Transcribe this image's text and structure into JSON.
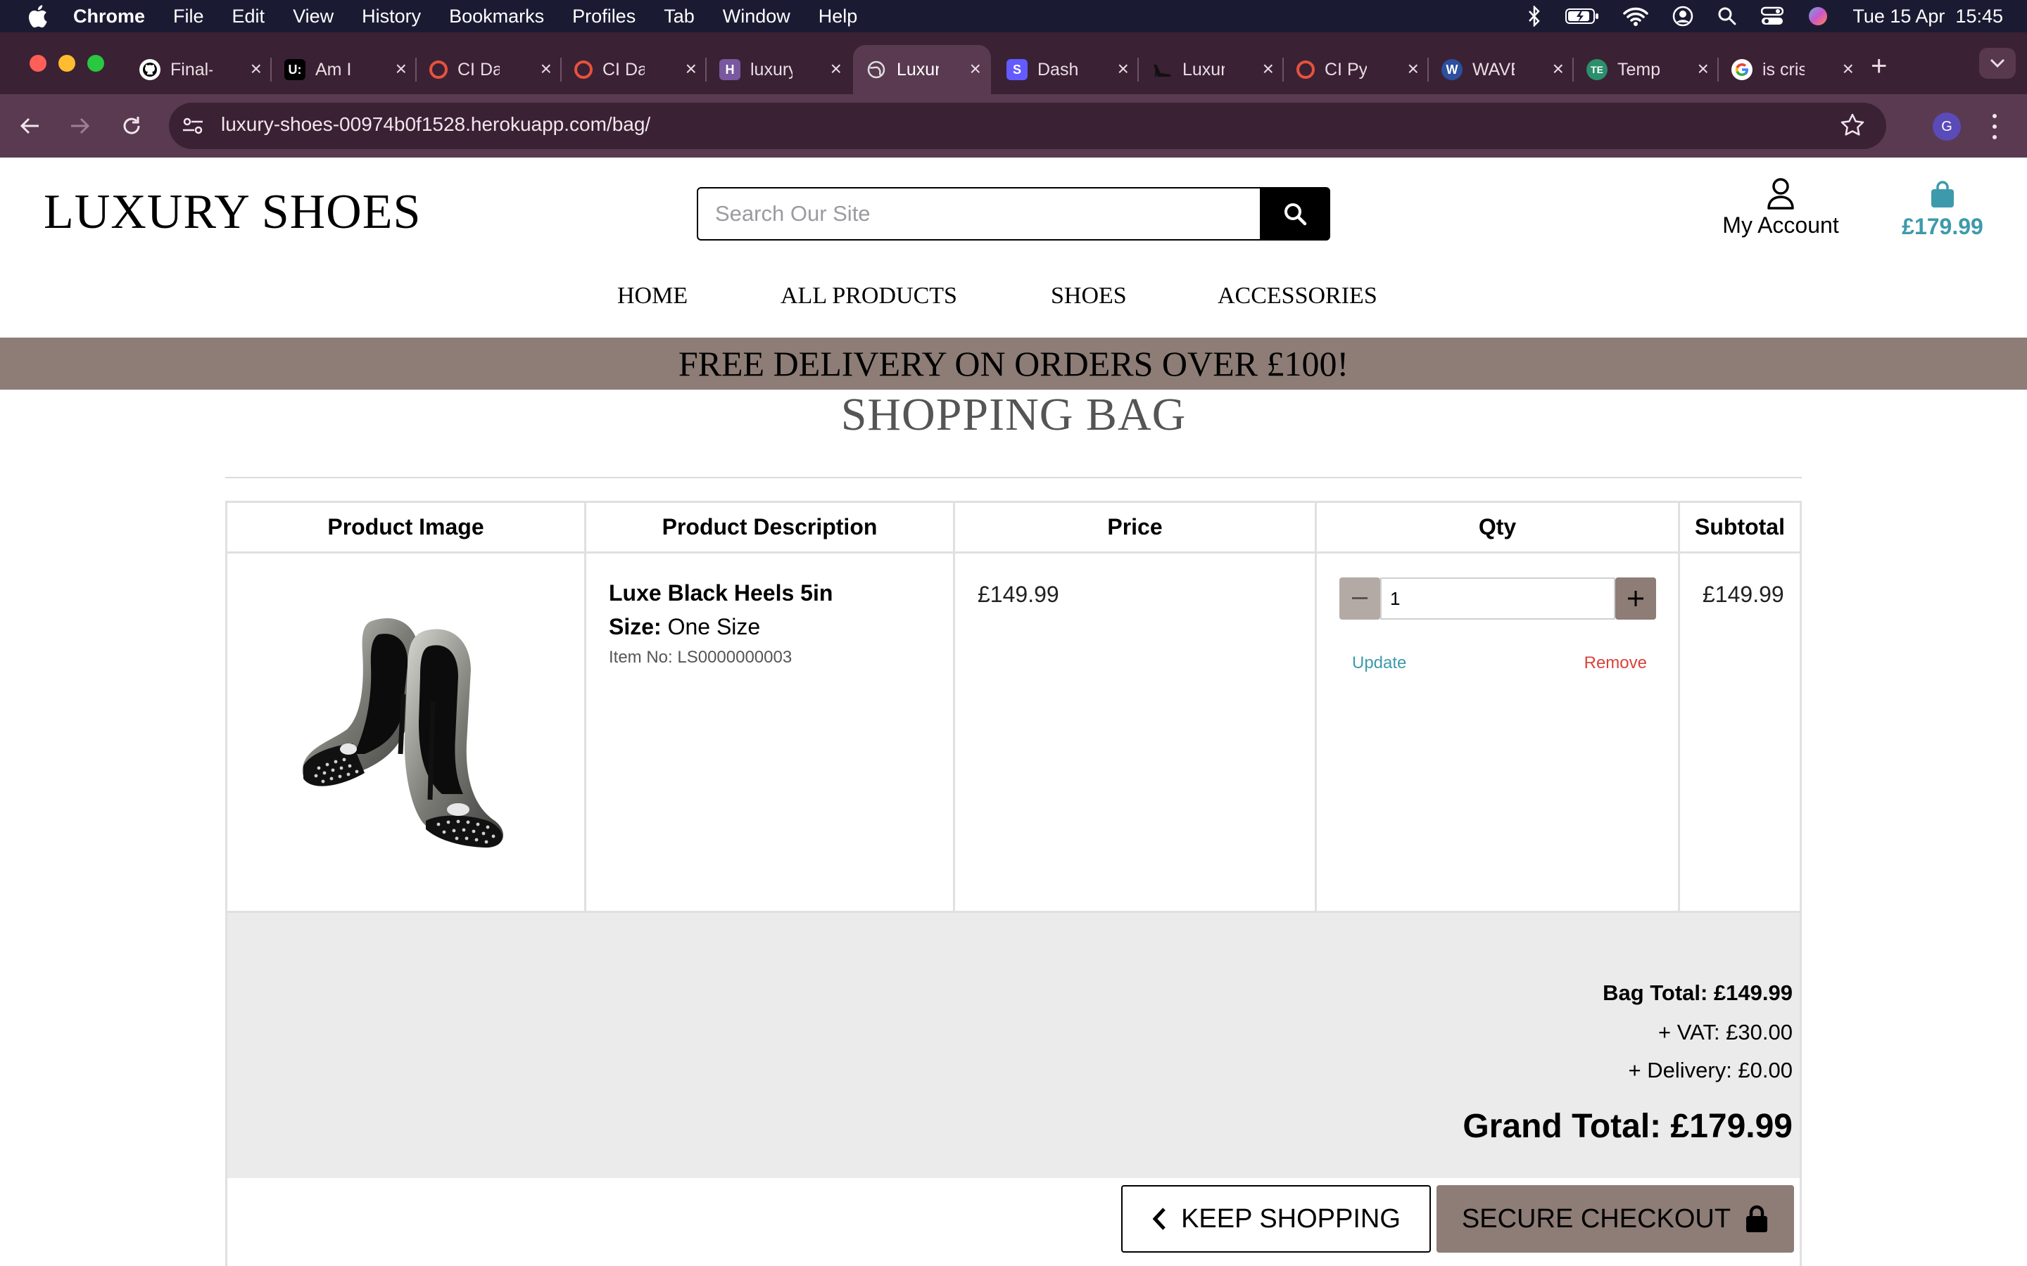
{
  "menubar": {
    "app": "Chrome",
    "items": [
      "File",
      "Edit",
      "View",
      "History",
      "Bookmarks",
      "Profiles",
      "Tab",
      "Window",
      "Help"
    ],
    "clock": "Tue 15 Apr  15:45"
  },
  "tabs": [
    {
      "title": "Final-",
      "icon": "github-icon"
    },
    {
      "title": "Am I F",
      "icon": "amiresponsive-icon"
    },
    {
      "title": "CI Dat",
      "icon": "ci-icon"
    },
    {
      "title": "CI Dat",
      "icon": "ci-icon"
    },
    {
      "title": "luxury",
      "icon": "heroku-icon"
    },
    {
      "title": "Luxur",
      "icon": "globe-icon",
      "active": true
    },
    {
      "title": "Dashb",
      "icon": "stripe-icon"
    },
    {
      "title": "Luxur",
      "icon": "shoe-icon"
    },
    {
      "title": "CI Py",
      "icon": "ci-icon"
    },
    {
      "title": "WAVE",
      "icon": "wave-icon"
    },
    {
      "title": "Temp",
      "icon": "temp-icon"
    },
    {
      "title": "is cris",
      "icon": "google-icon"
    }
  ],
  "browser": {
    "url": "luxury-shoes-00974b0f1528.herokuapp.com/bag/",
    "profile_initial": "G"
  },
  "site": {
    "logo": "LUXURY SHOES",
    "search_placeholder": "Search Our Site",
    "account_label": "My Account",
    "bag_total": "£179.99",
    "nav": [
      "HOME",
      "ALL PRODUCTS",
      "SHOES",
      "ACCESSORIES"
    ],
    "banner": "FREE DELIVERY ON ORDERS OVER £100!"
  },
  "bag": {
    "title": "SHOPPING BAG",
    "headers": [
      "Product Image",
      "Product Description",
      "Price",
      "Qty",
      "Subtotal"
    ],
    "item": {
      "name": "Luxe Black Heels 5in",
      "size_label": "Size:",
      "size_value": "One Size",
      "sku": "Item No: LS0000000003",
      "price": "£149.99",
      "qty": "1",
      "update": "Update",
      "remove": "Remove",
      "subtotal": "£149.99"
    },
    "summary": {
      "bag_total": "Bag Total: £149.99",
      "vat": "+ VAT: £30.00",
      "delivery": "+ Delivery: £0.00",
      "grand_total": "Grand Total: £179.99"
    },
    "keep_shopping": "KEEP SHOPPING",
    "secure_checkout": "SECURE CHECKOUT"
  },
  "colors": {
    "accent_teal": "#3d9aac",
    "taupe": "#8d7d76",
    "remove_red": "#d9423a"
  }
}
